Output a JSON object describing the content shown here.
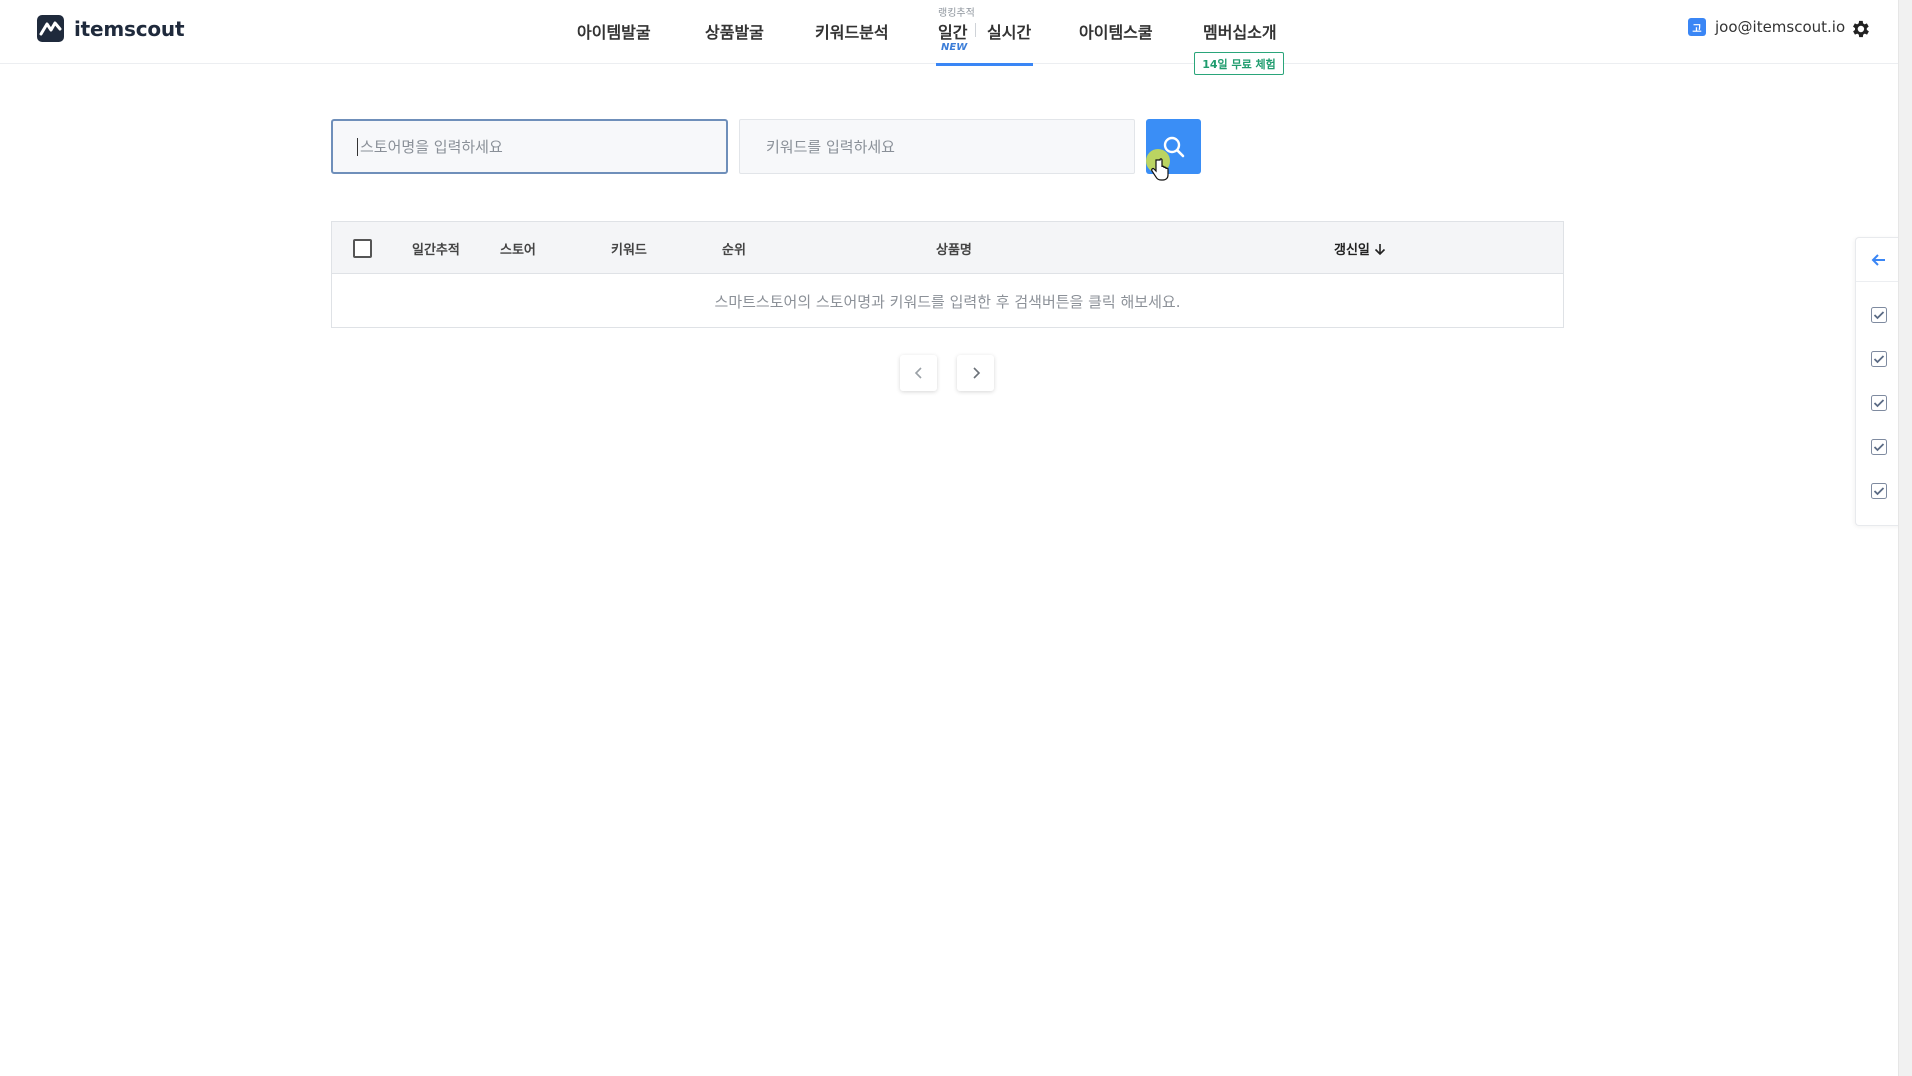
{
  "header": {
    "logo_text": "itemscout",
    "nav": {
      "item_discovery": "아이템발굴",
      "product_discovery": "상품발굴",
      "keyword_analysis": "키워드분석",
      "rank_tracking_caption": "랭킹추적",
      "daily": "일간",
      "daily_badge": "NEW",
      "realtime": "실시간",
      "item_school": "아이템스쿨",
      "membership": "멤버십소개",
      "trial_badge": "14일 무료 체험"
    },
    "user": {
      "badge_letter": "고",
      "email": "joo@itemscout.io"
    }
  },
  "search": {
    "store_placeholder": "스토어명을 입력하세요",
    "keyword_placeholder": "키워드를 입력하세요"
  },
  "table": {
    "columns": {
      "daily_tracking": "일간추적",
      "store": "스토어",
      "keyword": "키워드",
      "rank": "순위",
      "product_name": "상품명",
      "updated_date": "갱신일"
    },
    "empty_message": "스마트스토어의 스토어명과 키워드를 입력한 후 검색버튼을 클릭 해보세요."
  },
  "colors": {
    "accent": "#3a8ef6",
    "trial_green": "#1f9c6e",
    "logo_navy": "#1f2a3c"
  },
  "icons": [
    "itemscout-logo-icon",
    "gear-icon",
    "search-icon",
    "chevron-left-icon",
    "chevron-right-icon",
    "arrow-left-icon",
    "checkbox-checked-icon",
    "arrow-down-icon",
    "hand-cursor-icon"
  ]
}
